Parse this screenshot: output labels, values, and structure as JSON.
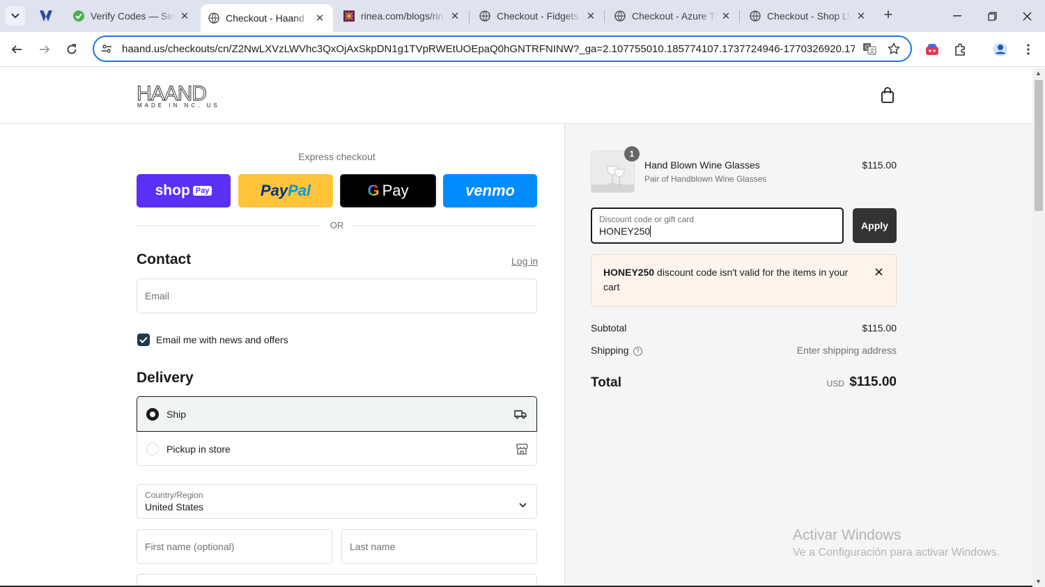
{
  "browser": {
    "tabs": [
      {
        "title": "Verify Codes — Sim",
        "favicon": "green-check-icon"
      },
      {
        "title": "Checkout - Haand",
        "favicon": "globe-icon",
        "active": true
      },
      {
        "title": "rinea.com/blogs/rin",
        "favicon": "rinea-icon"
      },
      {
        "title": "Checkout - Fidgets",
        "favicon": "globe-icon"
      },
      {
        "title": "Checkout - Azure Ta",
        "favicon": "globe-icon"
      },
      {
        "title": "Checkout - Shop LV",
        "favicon": "globe-icon"
      }
    ],
    "url": "haand.us/checkouts/cn/Z2NwLXVzLWVhc3QxOjAxSkpDN1g1TVpRWEtUOEpaQ0hGNTRFNINW?_ga=2.107755010.185774107.1737724946-1770326920.17..."
  },
  "store": {
    "logo_text": "HAAND",
    "logo_subtext": "MADE IN NC, USA"
  },
  "express": {
    "title": "Express checkout",
    "shop_pay": {
      "shop": "shop",
      "pay": "Pay"
    },
    "paypal": {
      "a": "Pay",
      "b": "Pal"
    },
    "gpay": {
      "g": "G",
      "pay": "Pay"
    },
    "venmo": "venmo",
    "or": "OR"
  },
  "contact": {
    "heading": "Contact",
    "login": "Log in",
    "email_placeholder": "Email",
    "newsletter_label": "Email me with news and offers",
    "newsletter_checked": true
  },
  "delivery": {
    "heading": "Delivery",
    "options": [
      {
        "label": "Ship",
        "selected": true,
        "icon": "truck-icon"
      },
      {
        "label": "Pickup in store",
        "selected": false,
        "icon": "store-icon"
      }
    ],
    "country_label": "Country/Region",
    "country_value": "United States",
    "first_name_placeholder": "First name (optional)",
    "last_name_placeholder": "Last name"
  },
  "summary": {
    "item": {
      "quantity": "1",
      "name": "Hand Blown Wine Glasses",
      "variant": "Pair of Handblown Wine Glasses",
      "price": "$115.00"
    },
    "discount_label": "Discount code or gift card",
    "discount_value": "HONEY250",
    "apply_label": "Apply",
    "error_code": "HONEY250",
    "error_text": " discount code isn't valid for the items in your cart",
    "subtotal_label": "Subtotal",
    "subtotal_value": "$115.00",
    "shipping_label": "Shipping",
    "shipping_value": "Enter shipping address",
    "total_label": "Total",
    "total_currency": "USD",
    "total_value": "$115.00"
  },
  "watermark": {
    "line1": "Activar Windows",
    "line2": "Ve a Configuración para activar Windows."
  }
}
